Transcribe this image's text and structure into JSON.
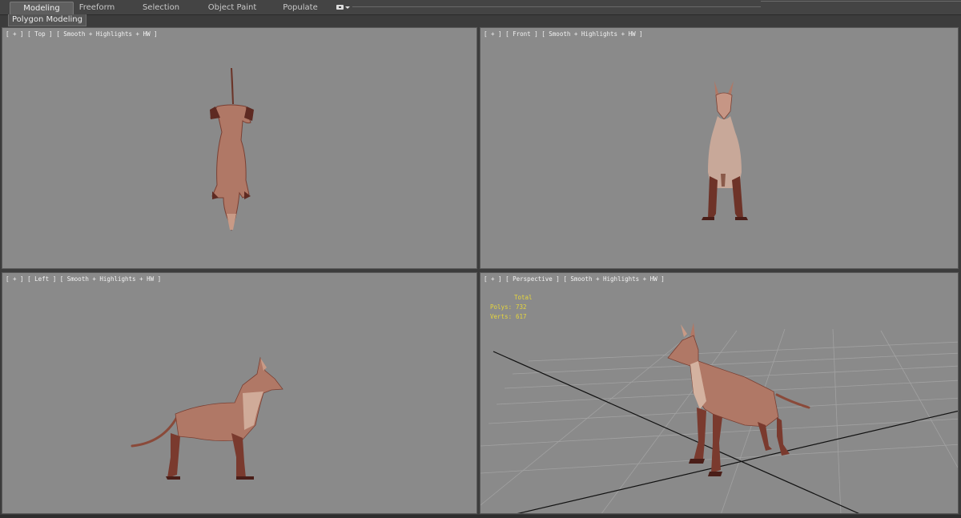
{
  "ribbon": {
    "tabs": [
      {
        "label": "Modeling",
        "active": true
      },
      {
        "label": "Freeform",
        "active": false
      },
      {
        "label": "Selection",
        "active": false
      },
      {
        "label": "Object Paint",
        "active": false
      },
      {
        "label": "Populate",
        "active": false
      }
    ],
    "subtab": "Polygon Modeling"
  },
  "viewports": {
    "top": {
      "label": "[ + ] [ Top ] [ Smooth + Highlights + HW ]"
    },
    "front": {
      "label": "[ + ] [ Front ] [ Smooth + Highlights + HW ]"
    },
    "left": {
      "label": "[ + ] [ Left ] [ Smooth + Highlights + HW ]"
    },
    "perspective": {
      "label": "[ + ] [ Perspective ] [ Smooth + Highlights + HW ]",
      "stats": {
        "header": "Total",
        "polys_label": "Polys:",
        "polys_value": "732",
        "verts_label": "Verts:",
        "verts_value": "617"
      }
    }
  },
  "colors": {
    "viewport_bg": "#8a8a8a",
    "model_body": "#b07866",
    "model_dark": "#5e2a22",
    "stats_text": "#e6d63c"
  }
}
